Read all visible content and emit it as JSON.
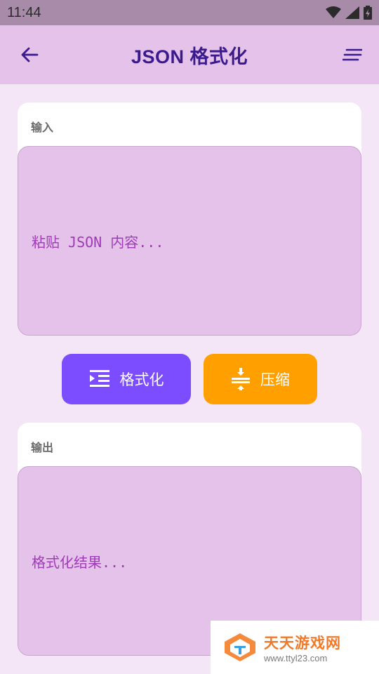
{
  "status_bar": {
    "time": "11:44"
  },
  "app_bar": {
    "title": "JSON 格式化"
  },
  "input_card": {
    "label": "输入",
    "placeholder": "粘贴 JSON 内容..."
  },
  "actions": {
    "format_label": "格式化",
    "compress_label": "压缩"
  },
  "output_card": {
    "label": "输出",
    "placeholder": "格式化结果..."
  },
  "watermark": {
    "name": "天天游戏网",
    "url": "www.ttyl23.com"
  },
  "colors": {
    "app_bar_bg": "#e4c2ea",
    "title": "#3b1a8f",
    "format_button": "#7c4dff",
    "compress_button": "#ffa000",
    "text_area_bg": "#e4c2ea",
    "placeholder": "#a03bb8"
  }
}
